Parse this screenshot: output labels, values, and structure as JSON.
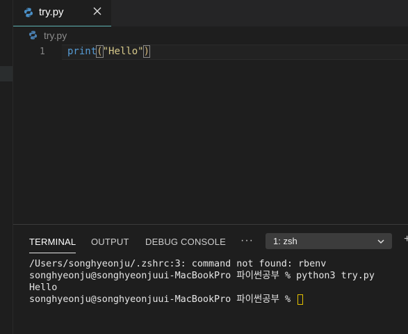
{
  "editor_tab": {
    "filename": "try.py",
    "close_icon": "close-icon",
    "file_icon": "python-icon"
  },
  "breadcrumb": {
    "filename": "try.py"
  },
  "editor": {
    "line_number": "1",
    "code": {
      "fn": "print",
      "open_paren": "(",
      "string": "\"Hello\"",
      "close_paren": ")"
    }
  },
  "panel": {
    "tabs": [
      {
        "label": "TERMINAL",
        "active": true
      },
      {
        "label": "OUTPUT"
      },
      {
        "label": "DEBUG CONSOLE"
      }
    ],
    "more": "···",
    "terminal_select": {
      "value": "1: zsh"
    },
    "plus": "+"
  },
  "terminal": {
    "lines": [
      "/Users/songhyeonju/.zshrc:3: command not found: rbenv",
      "songhyeonju@songhyeonjuui-MacBookPro 파이썬공부 % python3 try.py",
      "Hello",
      "songhyeonju@songhyeonjuui-MacBookPro 파이썬공부 % "
    ]
  },
  "colors": {
    "tab_underline": "#5fb3b3",
    "function": "#569cd6",
    "string": "#d7c98a",
    "cursor": "#e5c100"
  }
}
